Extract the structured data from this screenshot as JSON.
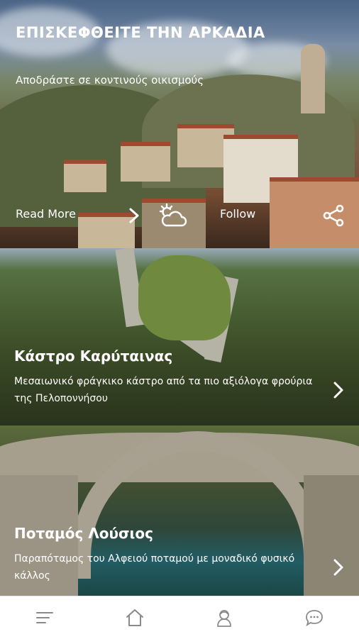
{
  "hero": {
    "title": "ΕΠΙΣΚΕΦΘΕΙΤΕ ΤΗΝ ΑΡΚΑΔΙΑ",
    "subtitle": "Αποδράστε σε κοντινούς οικισμούς",
    "read_more_label": "Read More",
    "follow_label": "Follow",
    "icons": [
      "chevron-right-icon",
      "weather-icon",
      "share-icon"
    ]
  },
  "cards": [
    {
      "title": "Κάστρο Καρύταινας",
      "description": "Μεσαιωνικό φράγκικο κάστρο από τα πιο αξιόλογα φρούρια της Πελοποννήσου",
      "icon": "chevron-right-icon"
    },
    {
      "title": "Ποταμός Λούσιος",
      "description": "Παραπόταμος του Αλφειού ποταμού με μοναδικό φυσικό κάλλος",
      "icon": "chevron-right-icon"
    }
  ],
  "tabbar": {
    "items": [
      "menu-icon",
      "home-icon",
      "user-icon",
      "chat-icon"
    ]
  },
  "colors": {
    "text_on_image": "#ffffff",
    "tab_icon": "#8a8a8a"
  }
}
